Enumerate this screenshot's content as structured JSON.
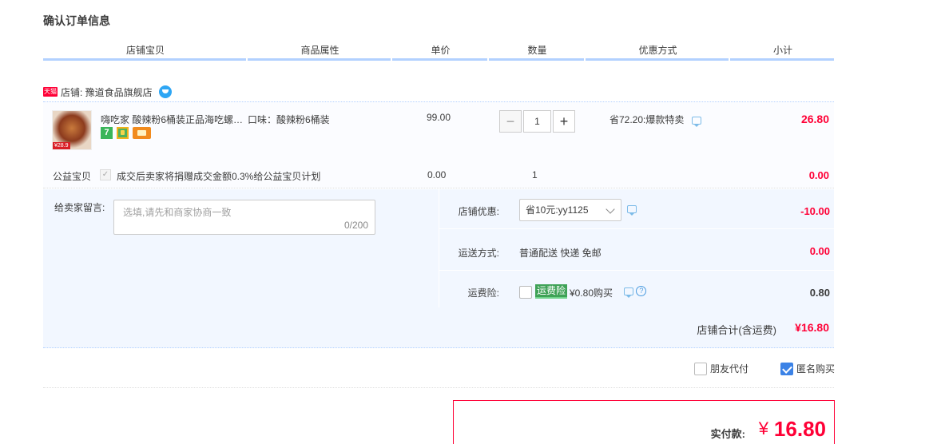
{
  "page_title": "确认订单信息",
  "columns": [
    "店铺宝贝",
    "商品属性",
    "单价",
    "数量",
    "优惠方式",
    "小计"
  ],
  "shop": {
    "badge": "天猫",
    "label": "店铺: 豫道食品旗舰店"
  },
  "item": {
    "thumb_tag": "¥28.9",
    "title": "嗨吃家 酸辣粉6桶装正品海吃螺蛳粉",
    "attr": "口味：酸辣粉6桶装",
    "unit_price": "99.00",
    "quantity": "1",
    "promo": "省72.20:爆款特卖",
    "subtotal": "26.80",
    "icon_seven": "7"
  },
  "charity": {
    "label": "公益宝贝",
    "text": "成交后卖家将捐赠成交金额0.3%给公益宝贝计划",
    "price": "0.00",
    "qty": "1",
    "subtotal": "0.00"
  },
  "message": {
    "label": "给卖家留言:",
    "placeholder": "选填,请先和商家协商一致",
    "count": "0/200"
  },
  "shop_coupon": {
    "label": "店铺优惠:",
    "selected": "省10元:yy1125",
    "amount": "-10.00"
  },
  "shipping": {
    "label": "运送方式:",
    "method": "普通配送 快递 免邮",
    "amount": "0.00"
  },
  "insurance": {
    "label": "运费险:",
    "badge": "运费险",
    "price": "¥0.80购买",
    "amount": "0.80"
  },
  "shop_total": {
    "label": "店铺合计(含运费)",
    "amount": "¥16.80"
  },
  "options": {
    "friend_pay": "朋友代付",
    "anonymous": "匿名购买",
    "anonymous_checked": true
  },
  "payment": {
    "label": "实付款:",
    "currency": "¥",
    "amount": "16.80"
  },
  "colors": {
    "accent_red": "#ff0036",
    "header_bar": "#b2d1ff",
    "panel_bg": "#f2f7ff",
    "checkbox_blue": "#3b82e6"
  }
}
